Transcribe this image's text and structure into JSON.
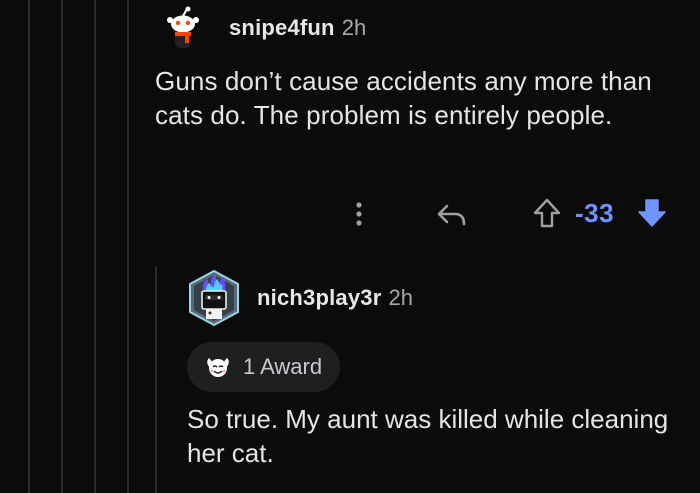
{
  "comments": [
    {
      "username": "snipe4fun",
      "timestamp": "2h",
      "avatar_icon": "snoo-avatar-icon",
      "body": "Guns don’t cause accidents any more than cats do. The problem is entirely people.",
      "actions": {
        "more_icon": "more-vertical-icon",
        "reply_icon": "reply-arrow-icon",
        "upvote_icon": "upvote-arrow-icon",
        "score": "-33",
        "downvote_icon": "downvote-arrow-icon"
      }
    },
    {
      "username": "nich3play3r",
      "timestamp": "2h",
      "avatar_icon": "robot-flame-avatar-icon",
      "award": {
        "icon": "wholesome-award-icon",
        "label": "1 Award"
      },
      "body": "So true. My aunt was killed while cleaning her cat."
    }
  ],
  "colors": {
    "background": "#0b0b0c",
    "thread_line": "#2a2b2d",
    "text": "#e3e5e7",
    "muted": "#a6a8ab",
    "downvote_accent": "#7193ff",
    "award_chip": "#1e1f21"
  }
}
